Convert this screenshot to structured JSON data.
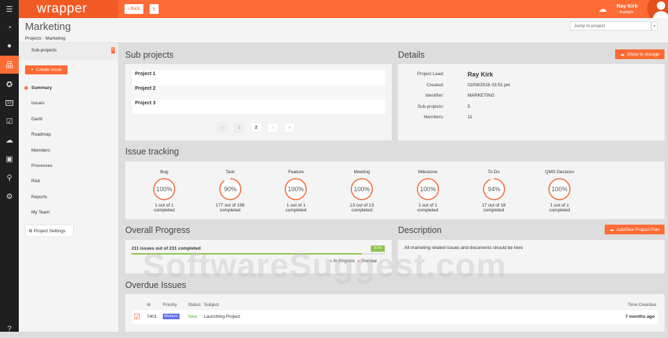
{
  "app": {
    "logo": "wrapper",
    "back_label": "Back",
    "user_name": "Ray Kirk",
    "user_status": "Available",
    "accent": "#ff6b35"
  },
  "rail": {
    "icons": [
      "menu-icon",
      "dashboard-icon",
      "chat-icon",
      "hierarchy-icon",
      "award-icon",
      "calendar-icon",
      "checklist-icon",
      "cloud-icon",
      "badge-icon",
      "search-icon",
      "settings-icon",
      "help-icon"
    ],
    "calendar_day": "15"
  },
  "header": {
    "title": "Marketing",
    "breadcrumb": [
      "Projects",
      "Marketing"
    ],
    "jump_placeholder": "Jump to project"
  },
  "nav": {
    "subprojects_label": "Sub-projects",
    "subprojects_badge": "5",
    "create_label": "Create Issue",
    "items": [
      "Summary",
      "Issues",
      "Gantt",
      "Roadmap",
      "Members",
      "Processes",
      "Risk",
      "Reports",
      "My Team"
    ],
    "active": "Summary",
    "settings_label": "Project Settings"
  },
  "subprojects": {
    "title": "Sub projects",
    "items": [
      "Project 1",
      "Project 2",
      "Project 3"
    ],
    "pages": [
      "‹",
      "1",
      "2",
      "›",
      "»"
    ],
    "current_page": "2"
  },
  "details": {
    "title": "Details",
    "storage_label": "Show in storage",
    "rows": [
      {
        "label": "Project Lead:",
        "value": "Ray Kirk"
      },
      {
        "label": "Created:",
        "value": "02/09/2016 03:51 pm"
      },
      {
        "label": "Identifier:",
        "value": "MARKETING"
      },
      {
        "label": "Sub-projects:",
        "value": "5"
      },
      {
        "label": "Members:",
        "value": "11"
      }
    ]
  },
  "tracking": {
    "title": "Issue tracking",
    "items": [
      {
        "name": "Bug",
        "pct": 100,
        "pct_label": "100%",
        "line1": "1 out of 1",
        "line2": "completed"
      },
      {
        "name": "Task",
        "pct": 90,
        "pct_label": "90%",
        "line1": "177 out of 196",
        "line2": "completed"
      },
      {
        "name": "Feature",
        "pct": 100,
        "pct_label": "100%",
        "line1": "1 out of 1",
        "line2": "completed"
      },
      {
        "name": "Meeting",
        "pct": 100,
        "pct_label": "100%",
        "line1": "13 out of 13",
        "line2": "completed"
      },
      {
        "name": "Milestone",
        "pct": 100,
        "pct_label": "100%",
        "line1": "1 out of 1",
        "line2": "completed"
      },
      {
        "name": "To Do",
        "pct": 94,
        "pct_label": "94%",
        "line1": "17 out of 18",
        "line2": "completed"
      },
      {
        "name": "QMS Decision",
        "pct": 100,
        "pct_label": "100%",
        "line1": "1 out of 1",
        "line2": "completed"
      }
    ]
  },
  "progress": {
    "title": "Overall Progress",
    "summary": "211 issues out of 231 completed",
    "pct": 91,
    "pct_label": "91%",
    "legend_in_progress": "In Progress",
    "legend_overdue": "Overdue",
    "green": "#8bc34a",
    "red": "#f4511e"
  },
  "description": {
    "title": "Description",
    "button_label": "Add/See Project Plan",
    "text": "All marketing related issues and documents should be here"
  },
  "overdue": {
    "title": "Overdue Issues",
    "headers": [
      "Id",
      "Priority",
      "Status",
      "Subject",
      "Time Overdue"
    ],
    "rows": [
      {
        "id": "7401",
        "priority": "Medium",
        "status": "New",
        "subject": "Launching Project",
        "time": "7 months ago"
      }
    ]
  },
  "watermark": "SoftwareSuggest.com"
}
